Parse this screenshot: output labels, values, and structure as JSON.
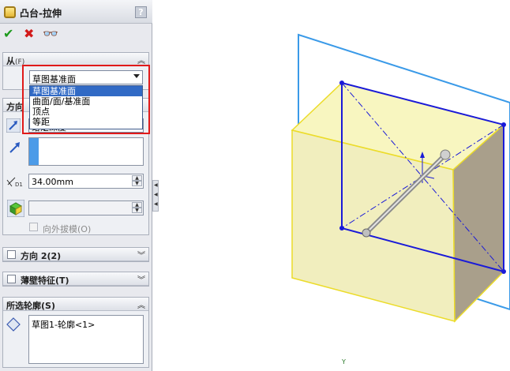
{
  "panel": {
    "title": "凸台-拉伸",
    "help": "?",
    "actions": {
      "ok": "✔",
      "cancel": "✖",
      "preview": "👓"
    }
  },
  "from_group": {
    "label": "从",
    "shortcut": "(F)",
    "selected": "草图基准面",
    "options": [
      "草图基准面",
      "曲面/面/基准面",
      "顶点",
      "等距"
    ]
  },
  "direction1": {
    "label": "方向",
    "end_condition": "给定深度",
    "depth": "34.00mm",
    "draft_outward": "向外拔模(O)"
  },
  "direction2": {
    "label": "方向 2(2)"
  },
  "thin_feature": {
    "label": "薄壁特征(T)"
  },
  "contours": {
    "label": "所选轮廓(S)",
    "item": "草图1-轮廓<1>"
  },
  "triad": {
    "y_label": "Y"
  },
  "colors": {
    "accent_selection": "#316ac5",
    "highlight_box": "#e01a1a",
    "sketch_blue": "#1a1ad8",
    "plane_blue": "#3a9ae8",
    "extrude_yellow": "#f6f3b8"
  }
}
